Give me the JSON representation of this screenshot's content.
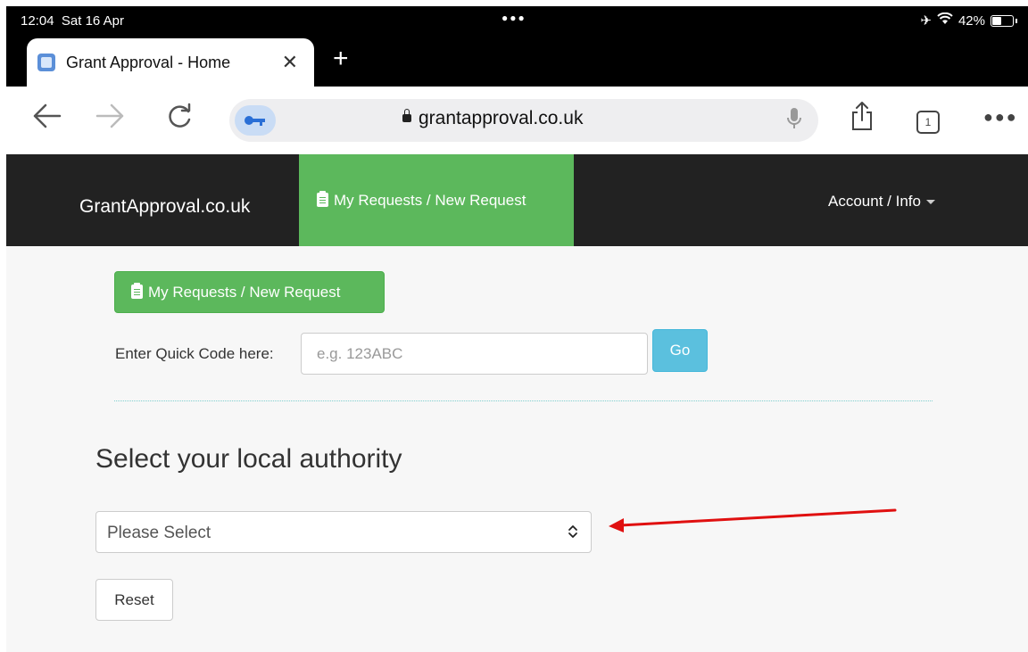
{
  "status_bar": {
    "time": "12:04",
    "date": "Sat 16 Apr",
    "battery": "42%",
    "battery_level": 0.42
  },
  "browser": {
    "tab_title": "Grant Approval - Home",
    "url": "grantapproval.co.uk",
    "tab_count": "1",
    "icons": {
      "back": "back-arrow-icon",
      "forward": "forward-arrow-icon",
      "reload": "reload-icon",
      "key": "key-icon",
      "mic": "mic-icon",
      "share": "share-icon",
      "more": "more-icon"
    }
  },
  "site_nav": {
    "brand": "GrantApproval.co.uk",
    "active_item": "My Requests / New Request",
    "account": "Account / Info"
  },
  "main": {
    "requests_button": "My Requests / New Request",
    "quick_code_label": "Enter Quick Code here:",
    "quick_code_placeholder": "e.g. 123ABC",
    "quick_code_value": "",
    "go_button": "Go",
    "heading": "Select your local authority",
    "select_value": "Please Select",
    "reset_button": "Reset"
  },
  "colors": {
    "nav_bg": "#222222",
    "accent_green": "#5cb85c",
    "go_blue": "#5bc0de",
    "annotation_red": "#e01010"
  }
}
